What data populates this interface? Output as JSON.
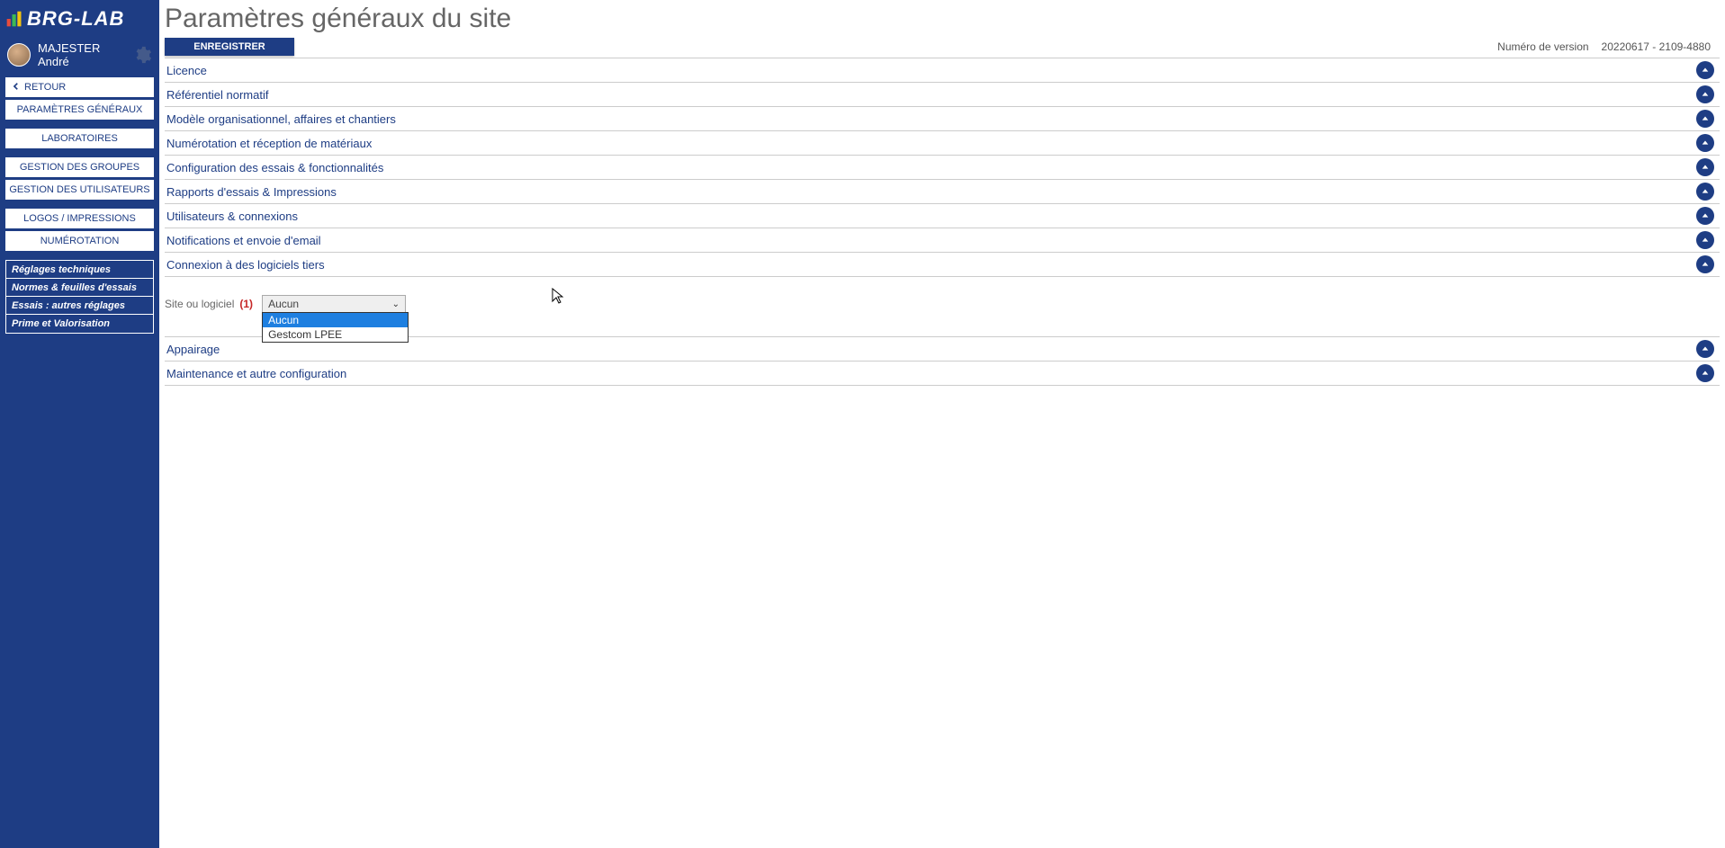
{
  "app": {
    "logo_text": "BRG-LAB",
    "user_name": "MAJESTER André"
  },
  "sidebar": {
    "back": "RETOUR",
    "items_group1": [
      "PARAMÈTRES GÉNÉRAUX"
    ],
    "items_group2": [
      "LABORATOIRES"
    ],
    "items_group3": [
      "GESTION DES GROUPES",
      "GESTION DES UTILISATEURS"
    ],
    "items_group4": [
      "LOGOS / IMPRESSIONS",
      "NUMÉROTATION"
    ],
    "items_group5": [
      "Réglages techniques",
      "Normes & feuilles d'essais",
      "Essais : autres réglages",
      "Prime et Valorisation"
    ]
  },
  "main": {
    "title": "Paramètres généraux du site",
    "save_label": "ENREGISTRER",
    "version_label": "Numéro de version",
    "version_value": "20220617 - 2109-4880"
  },
  "sections": [
    {
      "label": "Licence"
    },
    {
      "label": "Référentiel normatif"
    },
    {
      "label": "Modèle organisationnel, affaires et chantiers"
    },
    {
      "label": "Numérotation et réception de matériaux"
    },
    {
      "label": "Configuration des essais & fonctionnalités"
    },
    {
      "label": "Rapports d'essais & Impressions"
    },
    {
      "label": "Utilisateurs & connexions"
    },
    {
      "label": "Notifications et envoie d'email"
    },
    {
      "label": "Connexion à des logiciels tiers",
      "expanded": true
    },
    {
      "label": "Appairage"
    },
    {
      "label": "Maintenance et autre configuration"
    }
  ],
  "third_party": {
    "field_label": "Site ou logiciel",
    "marker": "(1)",
    "selected": "Aucun",
    "options": [
      "Aucun",
      "Gestcom LPEE"
    ]
  }
}
